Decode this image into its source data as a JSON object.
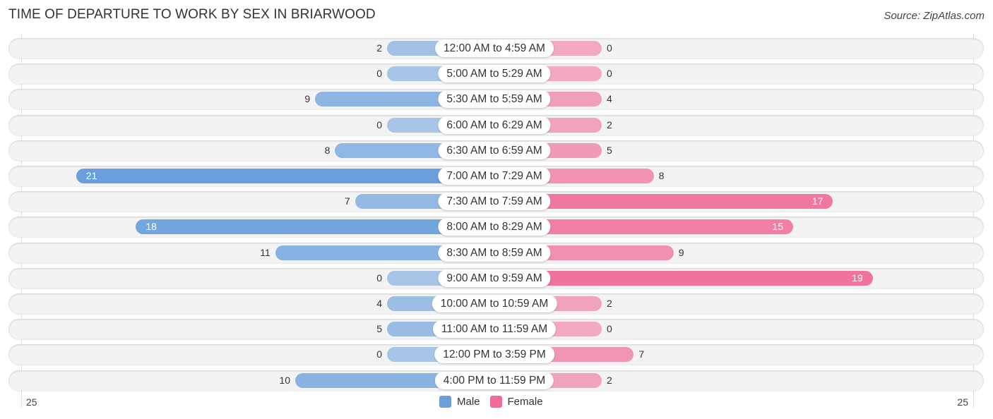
{
  "chart_data": {
    "type": "bar",
    "orientation": "horizontal-diverging",
    "title": "TIME OF DEPARTURE TO WORK BY SEX IN BRIARWOOD",
    "source": "Source: ZipAtlas.com",
    "categories": [
      "12:00 AM to 4:59 AM",
      "5:00 AM to 5:29 AM",
      "5:30 AM to 5:59 AM",
      "6:00 AM to 6:29 AM",
      "6:30 AM to 6:59 AM",
      "7:00 AM to 7:29 AM",
      "7:30 AM to 7:59 AM",
      "8:00 AM to 8:29 AM",
      "8:30 AM to 8:59 AM",
      "9:00 AM to 9:59 AM",
      "10:00 AM to 10:59 AM",
      "11:00 AM to 11:59 AM",
      "12:00 PM to 3:59 PM",
      "4:00 PM to 11:59 PM"
    ],
    "series": [
      {
        "name": "Male",
        "color": "#6a9fdc",
        "values": [
          2,
          0,
          9,
          0,
          8,
          21,
          7,
          18,
          11,
          0,
          4,
          5,
          0,
          10
        ]
      },
      {
        "name": "Female",
        "color": "#f06c98",
        "values": [
          0,
          0,
          4,
          2,
          5,
          8,
          17,
          15,
          9,
          19,
          2,
          0,
          7,
          2
        ]
      }
    ],
    "xlim": [
      -25,
      25
    ],
    "axis_labels": {
      "left": "25",
      "right": "25"
    },
    "legend": {
      "placement": "bottom-center",
      "items": [
        "Male",
        "Female"
      ]
    }
  }
}
